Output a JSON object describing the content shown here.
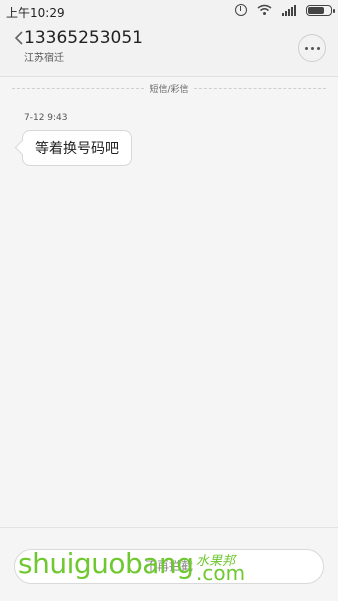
{
  "status_bar": {
    "time": "上午10:29",
    "icons": [
      "alarm-icon",
      "wifi-icon",
      "signal-icon",
      "battery-icon"
    ]
  },
  "header": {
    "number": "13365253051",
    "location": "江苏宿迁",
    "back_icon": "chevron-left-icon",
    "more_icon": "more-horizontal-icon"
  },
  "conversation": {
    "divider_label": "短信/彩信",
    "messages": [
      {
        "time": "7-12 9:43",
        "text": "等着换号码吧",
        "direction": "incoming"
      }
    ]
  },
  "input": {
    "text": "不再拦截"
  },
  "watermark": {
    "main": "shuiguobang",
    "cn": "水果邦",
    "suffix": ".com"
  },
  "colors": {
    "background": "#f5f5f5",
    "watermark": "#6fc82f"
  }
}
